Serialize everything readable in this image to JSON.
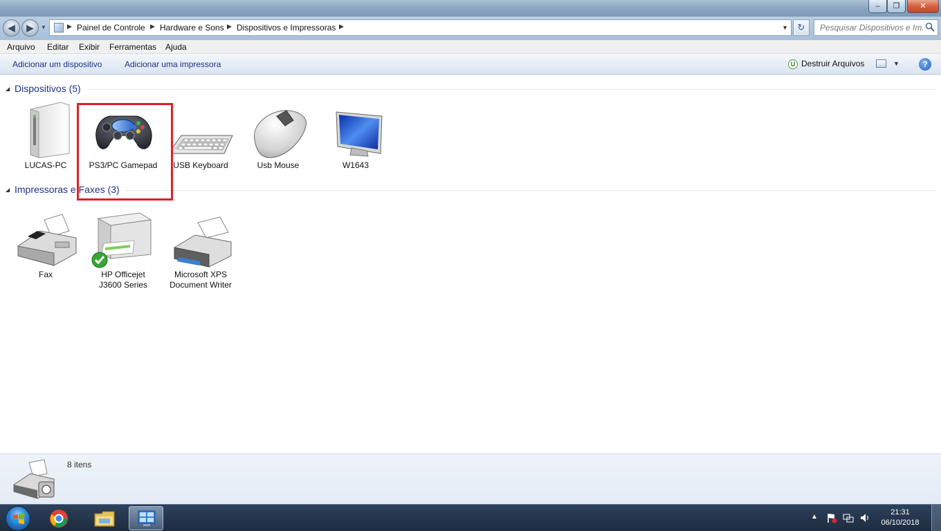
{
  "window": {
    "controls": {
      "minimize": "–",
      "maximize": "❐",
      "close": "✕"
    }
  },
  "address": {
    "breadcrumbs": [
      "Painel de Controle",
      "Hardware e Sons",
      "Dispositivos e Impressoras"
    ],
    "search_placeholder": "Pesquisar Dispositivos e Im..."
  },
  "menu": [
    "Arquivo",
    "Editar",
    "Exibir",
    "Ferramentas",
    "Ajuda"
  ],
  "toolbar": {
    "add_device": "Adicionar um dispositivo",
    "add_printer": "Adicionar uma impressora",
    "destruir": "Destruir Arquivos",
    "destruir_icon_glyph": "U"
  },
  "groups": [
    {
      "title": "Dispositivos (5)",
      "items": [
        {
          "label": "LUCAS-PC",
          "icon": "computer-tower-icon"
        },
        {
          "label": "PS3/PC Gamepad",
          "icon": "gamepad-icon"
        },
        {
          "label": "USB Keyboard",
          "icon": "keyboard-icon"
        },
        {
          "label": "Usb Mouse",
          "icon": "mouse-icon"
        },
        {
          "label": "W1643",
          "icon": "monitor-icon"
        }
      ]
    },
    {
      "title": "Impressoras e Faxes (3)",
      "items": [
        {
          "label": "Fax",
          "icon": "fax-icon"
        },
        {
          "label": "HP Officejet J3600 Series",
          "label_lines": [
            "HP Officejet",
            "J3600 Series"
          ],
          "icon": "printer-icon",
          "default": true
        },
        {
          "label": "Microsoft XPS Document Writer",
          "label_lines": [
            "Microsoft XPS",
            "Document Writer"
          ],
          "icon": "xps-printer-icon"
        }
      ]
    }
  ],
  "details": {
    "count": "8 itens"
  },
  "taskbar": {
    "clock_time": "21:31",
    "clock_date": "06/10/2018"
  },
  "colors": {
    "accent_link": "#1e3287",
    "highlight_box": "#e31d25"
  }
}
